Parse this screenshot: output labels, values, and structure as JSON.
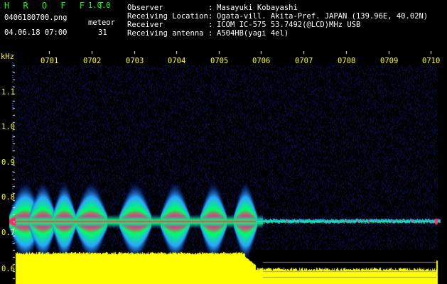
{
  "header": {
    "app_name": "H R O F F T",
    "version": "1.0.0",
    "filename": "0406180700.png",
    "meteor_label": "meteor",
    "datetime": "04.06.18 07:00",
    "meteor_count": "31"
  },
  "info": [
    {
      "key": "Observer",
      "value": "Masayuki Kobayashi"
    },
    {
      "key": "Receiving Location",
      "value": "Ogata-vill. Akita-Pref. JAPAN (139.96E, 40.02N)"
    },
    {
      "key": "Receiver",
      "value": "ICOM IC-575 53.7492(@LCD)MHz USB"
    },
    {
      "key": "Receiving antenna",
      "value": "A504HB(yagi 4el)"
    }
  ],
  "plot": {
    "y_unit": "kHz",
    "time_ticks": [
      "0701",
      "0702",
      "0703",
      "0704",
      "0705",
      "0706",
      "0707",
      "0708",
      "0709",
      "0710"
    ],
    "freq_ticks": [
      "1.1",
      "1.0",
      "0.9",
      "0.8",
      "0.7",
      "0.6"
    ],
    "colors": {
      "background": "#000000",
      "noise": "#00007a",
      "signal_core": "#ff2a6d",
      "signal_mid": "#00ff66",
      "signal_edge": "#2aa8ff",
      "level_bar": "#ffff00",
      "text_green": "#00ff00",
      "text_white": "#ffffff",
      "text_yellow": "#ffff00"
    }
  }
}
